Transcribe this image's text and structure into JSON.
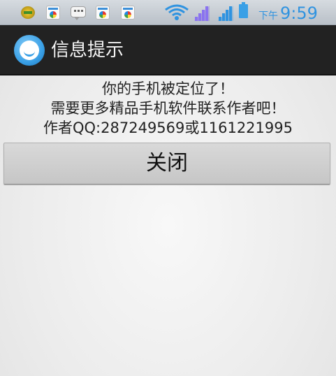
{
  "status_bar": {
    "ampm": "下午",
    "time": "9:59",
    "icons": [
      "android-notification-icon",
      "app-notification-icon",
      "message-notification-icon",
      "app-notification-icon",
      "app-notification-icon",
      "wifi-icon",
      "signal-icon",
      "signal-icon",
      "battery-icon"
    ],
    "accent_color": "#2f93e0"
  },
  "header": {
    "title": "信息提示",
    "icon": "app-smiley-icon"
  },
  "message": {
    "lines": [
      "你的手机被定位了！",
      "需要更多精品手机软件联系作者吧！",
      "作者QQ:287249569或1161221995"
    ]
  },
  "close_button": {
    "label": "关闭"
  }
}
